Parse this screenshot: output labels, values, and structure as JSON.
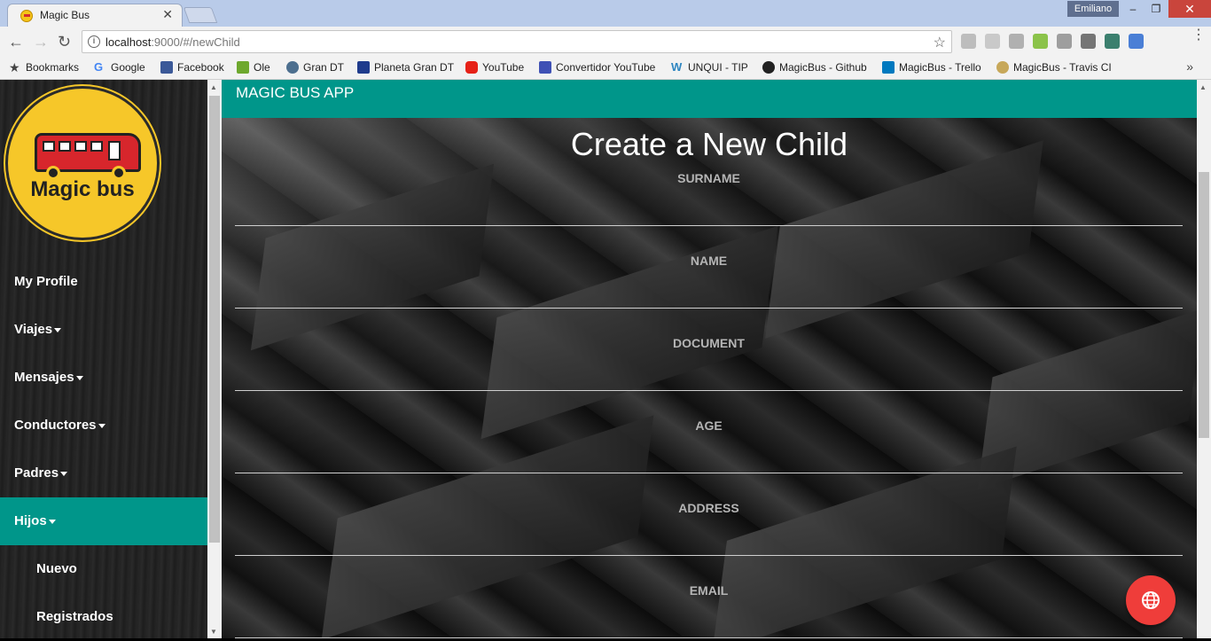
{
  "browser": {
    "tab_title": "Magic Bus",
    "profile_name": "Emiliano",
    "url_host": "localhost",
    "url_rest": ":9000/#/newChild",
    "bookmarks": [
      {
        "label": "Bookmarks",
        "icon": "star-icon"
      },
      {
        "label": "Google",
        "icon": "google-icon"
      },
      {
        "label": "Facebook",
        "icon": "facebook-icon"
      },
      {
        "label": "Ole",
        "icon": "ole-icon"
      },
      {
        "label": "Gran DT",
        "icon": "globe-icon"
      },
      {
        "label": "Planeta Gran DT",
        "icon": "planeta-icon"
      },
      {
        "label": "YouTube",
        "icon": "youtube-icon"
      },
      {
        "label": "Convertidor YouTube",
        "icon": "convertidor-icon"
      },
      {
        "label": "UNQUI - TIP",
        "icon": "unqui-icon"
      },
      {
        "label": "MagicBus - Github",
        "icon": "github-icon"
      },
      {
        "label": "MagicBus - Trello",
        "icon": "trello-icon"
      },
      {
        "label": "MagicBus - Travis CI",
        "icon": "travis-icon"
      }
    ]
  },
  "sidebar": {
    "logo_text": "Magic bus",
    "items": [
      {
        "label": "My Profile",
        "caret": false,
        "active": false,
        "sub": false
      },
      {
        "label": "Viajes",
        "caret": true,
        "active": false,
        "sub": false
      },
      {
        "label": "Mensajes",
        "caret": true,
        "active": false,
        "sub": false
      },
      {
        "label": "Conductores",
        "caret": true,
        "active": false,
        "sub": false
      },
      {
        "label": "Padres",
        "caret": true,
        "active": false,
        "sub": false
      },
      {
        "label": "Hijos",
        "caret": true,
        "active": true,
        "sub": false
      },
      {
        "label": "Nuevo",
        "caret": false,
        "active": false,
        "sub": true
      },
      {
        "label": "Registrados",
        "caret": false,
        "active": false,
        "sub": true
      }
    ]
  },
  "app": {
    "title": "MAGIC BUS APP",
    "accent": "#00968a",
    "fab_color": "#ef3d3a"
  },
  "form": {
    "title": "Create a New Child",
    "fields": [
      {
        "label": "SURNAME",
        "value": ""
      },
      {
        "label": "NAME",
        "value": ""
      },
      {
        "label": "DOCUMENT",
        "value": ""
      },
      {
        "label": "AGE",
        "value": ""
      },
      {
        "label": "ADDRESS",
        "value": ""
      },
      {
        "label": "EMAIL",
        "value": ""
      }
    ]
  }
}
